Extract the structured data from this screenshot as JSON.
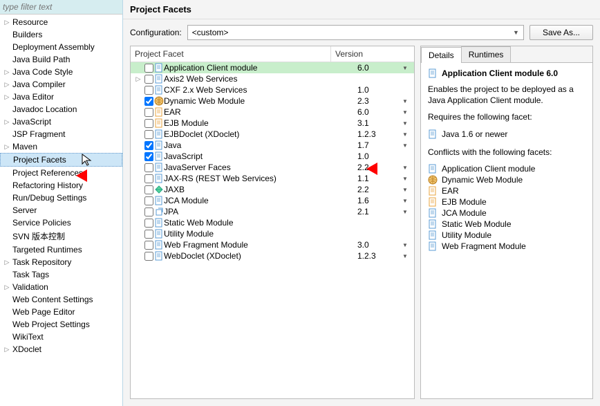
{
  "filter_placeholder": "type filter text",
  "header": "Project Facets",
  "config_label": "Configuration:",
  "config_value": "<custom>",
  "saveas_label": "Save As...",
  "sidebar": {
    "items": [
      {
        "label": "Resource",
        "expandable": true
      },
      {
        "label": "Builders"
      },
      {
        "label": "Deployment Assembly"
      },
      {
        "label": "Java Build Path"
      },
      {
        "label": "Java Code Style",
        "expandable": true
      },
      {
        "label": "Java Compiler",
        "expandable": true
      },
      {
        "label": "Java Editor",
        "expandable": true
      },
      {
        "label": "Javadoc Location"
      },
      {
        "label": "JavaScript",
        "expandable": true
      },
      {
        "label": "JSP Fragment"
      },
      {
        "label": "Maven",
        "expandable": true
      },
      {
        "label": "Project Facets",
        "selected": true
      },
      {
        "label": "Project References"
      },
      {
        "label": "Refactoring History"
      },
      {
        "label": "Run/Debug Settings"
      },
      {
        "label": "Server"
      },
      {
        "label": "Service Policies"
      },
      {
        "label": "SVN 版本控制"
      },
      {
        "label": "Targeted Runtimes"
      },
      {
        "label": "Task Repository",
        "expandable": true
      },
      {
        "label": "Task Tags"
      },
      {
        "label": "Validation",
        "expandable": true
      },
      {
        "label": "Web Content Settings"
      },
      {
        "label": "Web Page Editor"
      },
      {
        "label": "Web Project Settings"
      },
      {
        "label": "WikiText"
      },
      {
        "label": "XDoclet",
        "expandable": true
      }
    ]
  },
  "facet_header": {
    "name": "Project Facet",
    "version": "Version"
  },
  "facets": [
    {
      "name": "Application Client module",
      "ver": "6.0",
      "drop": true,
      "icon": "doc",
      "checked": false,
      "sel": true
    },
    {
      "name": "Axis2 Web Services",
      "ver": "",
      "icon": "doc",
      "checked": false,
      "expandable": true
    },
    {
      "name": "CXF 2.x Web Services",
      "ver": "1.0",
      "icon": "doc",
      "checked": false
    },
    {
      "name": "Dynamic Web Module",
      "ver": "2.3",
      "drop": true,
      "icon": "globe",
      "checked": true
    },
    {
      "name": "EAR",
      "ver": "6.0",
      "drop": true,
      "icon": "ear",
      "checked": false
    },
    {
      "name": "EJB Module",
      "ver": "3.1",
      "drop": true,
      "icon": "ejb",
      "checked": false
    },
    {
      "name": "EJBDoclet (XDoclet)",
      "ver": "1.2.3",
      "drop": true,
      "icon": "doc",
      "checked": false
    },
    {
      "name": "Java",
      "ver": "1.7",
      "drop": true,
      "icon": "java",
      "checked": true
    },
    {
      "name": "JavaScript",
      "ver": "1.0",
      "icon": "doc",
      "checked": true
    },
    {
      "name": "JavaServer Faces",
      "ver": "2.2",
      "drop": true,
      "icon": "doc",
      "checked": false
    },
    {
      "name": "JAX-RS (REST Web Services)",
      "ver": "1.1",
      "drop": true,
      "icon": "doc",
      "checked": false
    },
    {
      "name": "JAXB",
      "ver": "2.2",
      "drop": true,
      "icon": "jaxb",
      "checked": false
    },
    {
      "name": "JCA Module",
      "ver": "1.6",
      "drop": true,
      "icon": "jca",
      "checked": false
    },
    {
      "name": "JPA",
      "ver": "2.1",
      "drop": true,
      "icon": "jpa",
      "checked": false
    },
    {
      "name": "Static Web Module",
      "ver": "",
      "icon": "doc",
      "checked": false
    },
    {
      "name": "Utility Module",
      "ver": "",
      "icon": "doc",
      "checked": false
    },
    {
      "name": "Web Fragment Module",
      "ver": "3.0",
      "drop": true,
      "icon": "doc",
      "checked": false
    },
    {
      "name": "WebDoclet (XDoclet)",
      "ver": "1.2.3",
      "drop": true,
      "icon": "doc",
      "checked": false
    }
  ],
  "tabs": {
    "details": "Details",
    "runtimes": "Runtimes"
  },
  "details": {
    "title": "Application Client module 6.0",
    "desc": "Enables the project to be deployed as a Java Application Client module.",
    "req_label": "Requires the following facet:",
    "req": "Java 1.6 or newer",
    "conf_label": "Conflicts with the following facets:",
    "conflicts": [
      {
        "name": "Application Client module",
        "icon": "doc"
      },
      {
        "name": "Dynamic Web Module",
        "icon": "globe"
      },
      {
        "name": "EAR",
        "icon": "ear"
      },
      {
        "name": "EJB Module",
        "icon": "ejb"
      },
      {
        "name": "JCA Module",
        "icon": "jca"
      },
      {
        "name": "Static Web Module",
        "icon": "doc"
      },
      {
        "name": "Utility Module",
        "icon": "doc"
      },
      {
        "name": "Web Fragment Module",
        "icon": "doc"
      }
    ]
  }
}
